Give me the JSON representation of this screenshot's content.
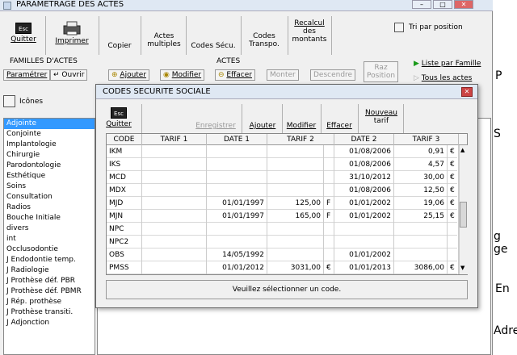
{
  "window": {
    "title": "PARAMETRAGE DES ACTES"
  },
  "toolbar": {
    "quitter": "Quitter",
    "imprimer": "Imprimer",
    "copier": "Copier",
    "actes_multiples_1": "Actes",
    "actes_multiples_2": "multiples",
    "codes_secu": "Codes Sécu.",
    "codes_transpo_1": "Codes",
    "codes_transpo_2": "Transpo.",
    "recalcul_1": "Recalcul",
    "recalcul_2": "des",
    "recalcul_3": "montants",
    "tri_par_position": "Tri par position"
  },
  "familles": {
    "header": "FAMILLES D'ACTES",
    "parametrer": "Paramétrer",
    "ouvrir": "Ouvrir",
    "icones": "Icônes",
    "items": [
      "Adjointe",
      "Conjointe",
      "Implantologie",
      "Chirurgie",
      "Parodontologie",
      "Esthétique",
      "Soins",
      "Consultation",
      "Radios",
      "Bouche Initiale",
      "divers",
      "int",
      "Occlusodontie",
      "J  Endodontie temp.",
      "J  Radiologie",
      "J  Prothèse déf. PBR",
      "J  Prothèse déf. PBMR",
      "J  Rép. prothèse",
      "J  Prothèse transiti.",
      "J  Adjonction"
    ]
  },
  "actes": {
    "header": "ACTES",
    "ajouter": "Ajouter",
    "modifier": "Modifier",
    "effacer": "Effacer",
    "monter": "Monter",
    "descendre": "Descendre",
    "raz_1": "Raz",
    "raz_2": "Position",
    "liste_par_famille": "Liste par Famille",
    "tous_les_actes": "Tous les actes"
  },
  "dialog": {
    "title": "CODES SECURITE SOCIALE",
    "quitter": "Quitter",
    "enregistrer": "Enregistrer",
    "ajouter": "Ajouter",
    "modifier": "Modifier",
    "effacer": "Effacer",
    "nouveau_1": "Nouveau",
    "nouveau_2": "tarif",
    "columns": [
      "CODE",
      "TARIF 1",
      "DATE 1",
      "TARIF 2",
      "DATE 2",
      "TARIF 3"
    ],
    "rows": [
      {
        "code": "IKM",
        "tarif1": "",
        "date1": "",
        "tarif2": "",
        "t2f": "",
        "date2": "01/08/2006",
        "tarif3": "0,91",
        "cur": "€"
      },
      {
        "code": "IKS",
        "tarif1": "",
        "date1": "",
        "tarif2": "",
        "t2f": "",
        "date2": "01/08/2006",
        "tarif3": "4,57",
        "cur": "€"
      },
      {
        "code": "MCD",
        "tarif1": "",
        "date1": "",
        "tarif2": "",
        "t2f": "",
        "date2": "31/10/2012",
        "tarif3": "30,00",
        "cur": "€"
      },
      {
        "code": "MDX",
        "tarif1": "",
        "date1": "",
        "tarif2": "",
        "t2f": "",
        "date2": "01/08/2006",
        "tarif3": "12,50",
        "cur": "€"
      },
      {
        "code": "MJD",
        "tarif1": "",
        "date1": "01/01/1997",
        "tarif2": "125,00",
        "t2f": "F",
        "date2": "01/01/2002",
        "tarif3": "19,06",
        "cur": "€"
      },
      {
        "code": "MJN",
        "tarif1": "",
        "date1": "01/01/1997",
        "tarif2": "165,00",
        "t2f": "F",
        "date2": "01/01/2002",
        "tarif3": "25,15",
        "cur": "€"
      },
      {
        "code": "NPC",
        "tarif1": "",
        "date1": "",
        "tarif2": "",
        "t2f": "",
        "date2": "",
        "tarif3": "",
        "cur": ""
      },
      {
        "code": "NPC2",
        "tarif1": "",
        "date1": "",
        "tarif2": "",
        "t2f": "",
        "date2": "",
        "tarif3": "",
        "cur": ""
      },
      {
        "code": "OBS",
        "tarif1": "",
        "date1": "14/05/1992",
        "tarif2": "",
        "t2f": "",
        "date2": "01/01/2002",
        "tarif3": "",
        "cur": ""
      },
      {
        "code": "PMSS",
        "tarif1": "",
        "date1": "01/01/2012",
        "tarif2": "3031,00",
        "t2f": "€",
        "date2": "01/01/2013",
        "tarif3": "3086,00",
        "cur": "€"
      }
    ],
    "status": "Veuillez sélectionner un code."
  },
  "background_text": [
    "P",
    "S",
    "g ge",
    "En",
    "Adre"
  ]
}
